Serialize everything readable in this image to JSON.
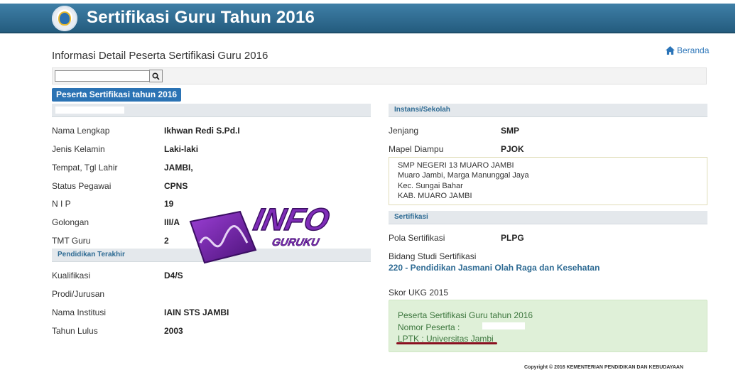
{
  "header": {
    "title": "Sertifikasi Guru Tahun 2016",
    "logo_icon": "tut-wuri-handayani-logo"
  },
  "page": {
    "title": "Informasi Detail Peserta Sertifikasi Guru 2016",
    "home_link": "Beranda"
  },
  "search": {
    "value": "",
    "placeholder": ""
  },
  "tab": {
    "label": "Peserta Sertifikasi tahun 2016"
  },
  "personal": {
    "fields": [
      {
        "label": "Nama Lengkap",
        "value": "Ikhwan Redi S.Pd.I"
      },
      {
        "label": "Jenis Kelamin",
        "value": "Laki-laki"
      },
      {
        "label": "Tempat, Tgl Lahir",
        "value": "JAMBI,"
      },
      {
        "label": "Status Pegawai",
        "value": "CPNS"
      },
      {
        "label": "N I P",
        "value": "19"
      },
      {
        "label": "Golongan",
        "value": "III/A"
      },
      {
        "label": "TMT Guru",
        "value": "2"
      }
    ]
  },
  "education": {
    "heading": "Pendidikan Terakhir",
    "fields": [
      {
        "label": "Kualifikasi",
        "value": "D4/S"
      },
      {
        "label": "Prodi/Jurusan",
        "value": ""
      },
      {
        "label": "Nama Institusi",
        "value": "IAIN STS JAMBI"
      },
      {
        "label": "Tahun Lulus",
        "value": "2003"
      }
    ]
  },
  "school": {
    "heading": "Instansi/Sekolah",
    "fields": [
      {
        "label": "Jenjang",
        "value": "SMP"
      },
      {
        "label": "Mapel Diampu",
        "value": "PJOK"
      }
    ],
    "address": [
      "SMP NEGERI 13 MUARO JAMBI",
      "Muaro Jambi, Marga Manunggal Jaya",
      "Kec. Sungai Bahar",
      "KAB. MUARO JAMBI"
    ]
  },
  "certification": {
    "heading": "Sertifikasi",
    "pola_label": "Pola Sertifikasi",
    "pola_value": "PLPG",
    "bidang_label": "Bidang Studi Sertifikasi",
    "bidang_value": "220 - Pendidikan Jasmani Olah Raga dan Kesehatan",
    "skor_label": "Skor UKG 2015",
    "box": {
      "line1": "Peserta Sertifikasi Guru tahun 2016",
      "line2": "Nomor Peserta :",
      "line3": "LPTK : Universitas Jambi"
    }
  },
  "footer": {
    "copyright": "Copyright © 2016 KEMENTERIAN PENDIDIKAN DAN KEBUDAYAAN"
  },
  "watermark": {
    "word1": "INFO",
    "word2": "GURUKU"
  },
  "colors": {
    "header": "#2d6a93",
    "accent": "#2b73b4",
    "success_bg": "#dff0d8",
    "success_text": "#3c763d",
    "underline": "#8a1020"
  }
}
